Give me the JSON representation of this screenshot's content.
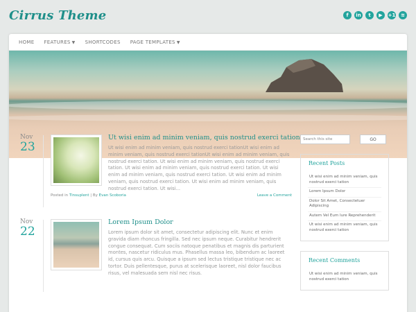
{
  "site": {
    "title": "Cirrus Theme"
  },
  "social": [
    {
      "glyph": "f",
      "icon": "facebook-icon"
    },
    {
      "glyph": "in",
      "icon": "linkedin-icon"
    },
    {
      "glyph": "t",
      "icon": "twitter-icon"
    },
    {
      "glyph": "▶",
      "icon": "youtube-icon"
    },
    {
      "glyph": "+1",
      "icon": "google-plus-icon"
    },
    {
      "glyph": "≋",
      "icon": "rss-icon"
    }
  ],
  "nav": {
    "items": [
      {
        "label": "HOME",
        "dropdown": false
      },
      {
        "label": "FEATURES",
        "dropdown": true
      },
      {
        "label": "SHORTCODES",
        "dropdown": false
      },
      {
        "label": "PAGE TEMPLATES",
        "dropdown": true
      }
    ]
  },
  "posts": [
    {
      "month": "Nov",
      "day": "23",
      "title": "Ut wisi enim ad minim veniam, quis nostrud exerci tation",
      "excerpt": "Ut wisi enim ad minim veniam, quis nostrud exerci tationUt wisi enim ad minim veniam, quis nostrud exerci tationUt wisi enim ad minim veniam, quis nostrud exerci tation. Ut wisi enim ad minim veniam, quis nostrud exerci tation. Ut wisi enim ad minim veniam, quis nostrud exerci tation. Ut wisi enim ad minim veniam, quis nostrud exerci tation. Ut wisi enim ad minim veniam, quis nostrud exerci tation. Ut wisi enim ad minim veniam, quis nostrud exerci tation. Ut wisi...",
      "posted_in_label": "Posted in",
      "category": "Tinsuplent",
      "by_label": "| By",
      "author": "Evan Scoboria",
      "comment_link": "Leave a Comment"
    },
    {
      "month": "Nov",
      "day": "22",
      "title": "Lorem Ipsum Dolor",
      "excerpt": "Lorem ipsum dolor sit amet, consectetur adipiscing elit. Nunc et enim gravida diam rhoncus fringilla. Sed nec ipsum neque. Curabitur hendrerit congue consequat. Cum sociis natoque penatibus et magnis dis parturient montes, nascetur ridiculus mus. Phasellus massa leo, bibendum ac laoreet id, cursus quis arcu. Quisque a ipsum sed lectus tristique tristique nec ac tortor. Duis pellentesque, purus at scelerisque laoreet, nisl dolor faucibus risus, vel malesuada sem nisl nec risus."
    }
  ],
  "sidebar": {
    "search_placeholder": "Search this site",
    "go_label": "GO",
    "recent_posts_title": "Recent Posts",
    "recent_posts": [
      "Ut wisi enim ad minim veniam, quis nostrud exerci tation",
      "Lorem Ipsum Dolor",
      "Dolor Sit Amet, Consectetuer Adipiscing",
      "Autem Vel Eum Iure Reprehenderit",
      "Ut wisi enim ad minim veniam, quis nostrud exerci tation"
    ],
    "recent_comments_title": "Recent Comments",
    "recent_comments": [
      "Ut wisi enim ad minim veniam, quis nostrud exerci tation"
    ]
  }
}
